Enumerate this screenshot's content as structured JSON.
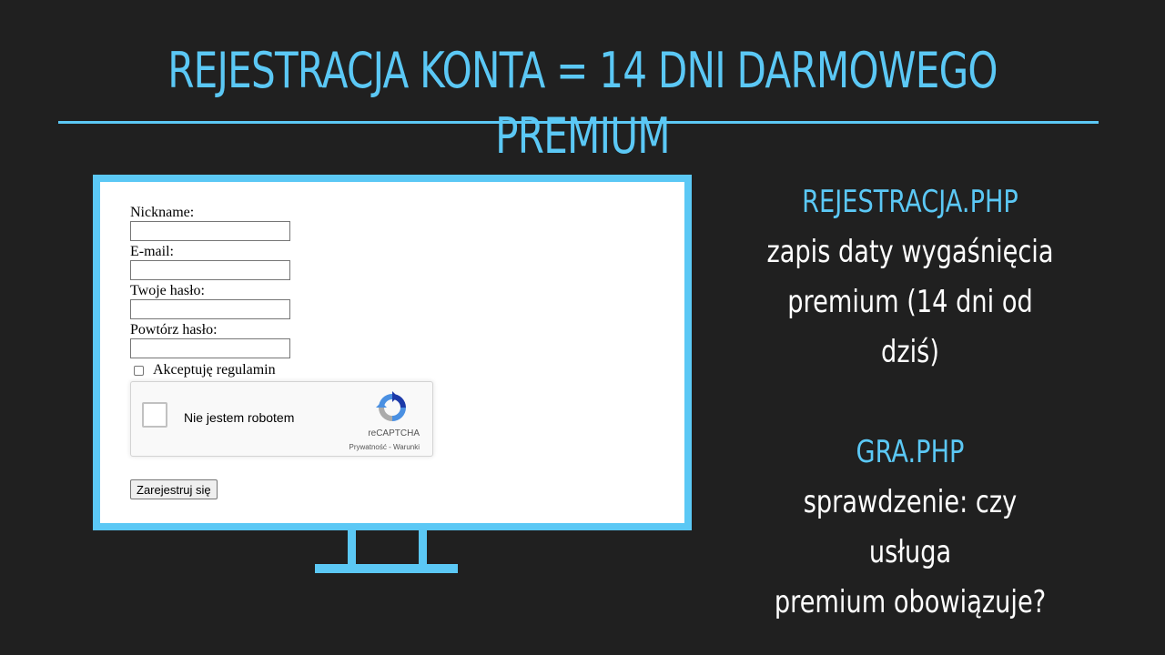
{
  "slide": {
    "title": "REJESTRACJA KONTA = 14 DNI DARMOWEGO PREMIUM"
  },
  "form": {
    "nickname_label": "Nickname:",
    "email_label": "E-mail:",
    "password_label": "Twoje hasło:",
    "password_repeat_label": "Powtórz hasło:",
    "terms_label": "Akceptuję regulamin",
    "recaptcha": {
      "label": "Nie jestem robotem",
      "brand": "reCAPTCHA",
      "links": "Prywatność - Warunki"
    },
    "submit_label": "Zarejestruj się"
  },
  "notes": {
    "file1": "REJESTRACJA.PHP",
    "file1_line1": "zapis daty wygaśnięcia",
    "file1_line2": "premium (14 dni od dziś)",
    "file2": "GRA.PHP",
    "file2_line1": "sprawdzenie: czy usługa",
    "file2_line2": "premium obowiązuje?"
  },
  "colors": {
    "accent": "#5bc8f5",
    "background": "#202020"
  }
}
